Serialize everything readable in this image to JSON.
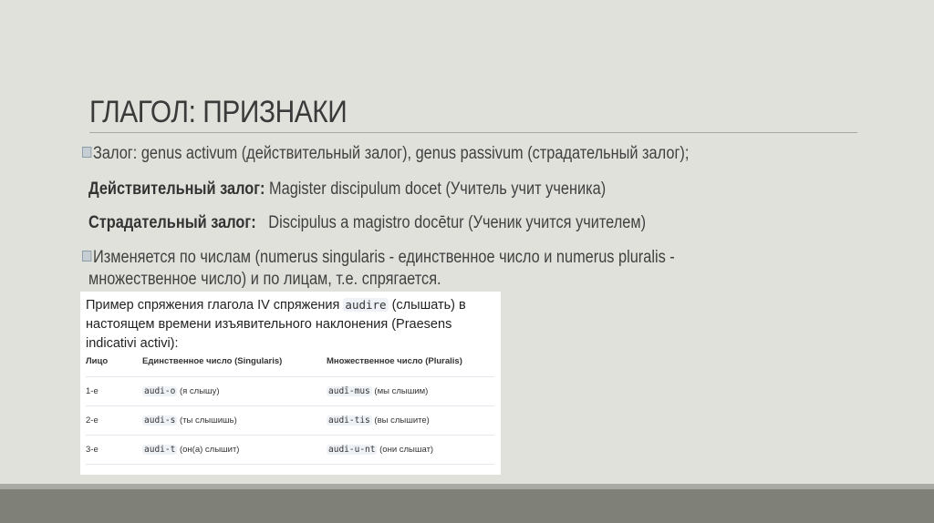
{
  "title": "ГЛАГОЛ: ПРИЗНАКИ",
  "bullets": {
    "voice": "Залог: genus activum (действительный залог), genus passivum (страдательный залог);",
    "active_label": "Действительный залог:",
    "active_text": " Magister discipulum docet (Учитель учит ученика)",
    "passive_label": "Страдательный залог:",
    "passive_text": "   Discipulus a magistro docētur (Ученик учится учителем)",
    "number_1": "Изменяется по числам (numerus singularis - единственное число и numerus pluralis -",
    "number_2": "множественное число) и по лицам, т.е. спрягается."
  },
  "table": {
    "caption_pre": "Пример спряжения глагола IV спряжения ",
    "caption_code": "audire",
    "caption_post": " (слышать) в настоящем времени изъявительного наклонения (Praesens indicativi activi):",
    "headers": [
      "Лицо",
      "Единственное число (Singularis)",
      "Множественное число (Pluralis)"
    ],
    "rows": [
      {
        "person": "1-е",
        "sg_code": "audi-o",
        "sg_text": " (я слышу)",
        "pl_code": "audī-mus",
        "pl_text": " (мы слышим)"
      },
      {
        "person": "2-е",
        "sg_code": "audi-s",
        "sg_text": " (ты слышишь)",
        "pl_code": "audi-tis",
        "pl_text": " (вы слышите)"
      },
      {
        "person": "3-е",
        "sg_code": "audi-t",
        "sg_text": " (он(а) слышит)",
        "pl_code": "audi-u-nt",
        "pl_text": " (они слышат)"
      }
    ]
  }
}
